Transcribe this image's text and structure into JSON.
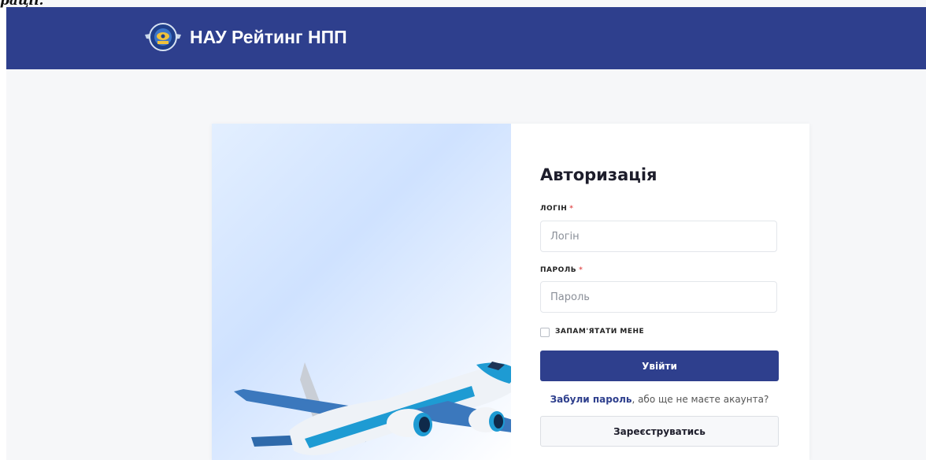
{
  "top_fragment": "рації.",
  "header": {
    "brand": "НАУ Рейтинг НПП",
    "color": "#2e3f8d"
  },
  "login": {
    "title": "Авторизація",
    "login_label": "ЛОГІН",
    "login_placeholder": "Логін",
    "password_label": "ПАРОЛЬ",
    "password_placeholder": "Пароль",
    "required_mark": "*",
    "remember_label": "ЗАПАМ'ЯТАТИ МЕНЕ",
    "submit_label": "Увійти",
    "forgot_link": "Забули пароль",
    "forgot_rest": ", або ще не маєте акаунта?",
    "register_label": "Зареєструватись"
  },
  "colors": {
    "primary": "#2e3f8d",
    "required": "#e25555",
    "background": "#f6f7f9"
  }
}
